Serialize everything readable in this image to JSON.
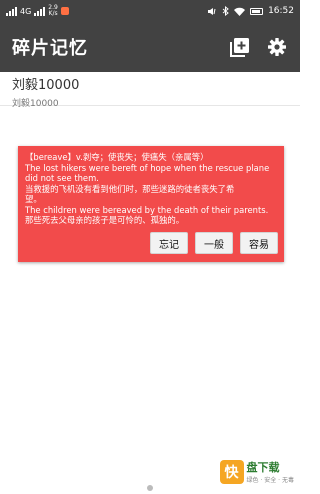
{
  "status_bar": {
    "signal_left": "4G",
    "speed_value": "2.9",
    "speed_unit": "K/s",
    "time": "16:52"
  },
  "app_bar": {
    "title": "碎片记忆",
    "add_icon": "add-note-icon",
    "settings_icon": "gear-icon"
  },
  "entry": {
    "title": "刘毅10000",
    "subtitle": "刘毅10000"
  },
  "card": {
    "lines": [
      "【bereave】v.剥夺；使丧失；使痛失（亲属等）",
      "The lost hikers were bereft of hope when the rescue plane",
      "did not see them.",
      "当救援的飞机没有看到他们时，那些迷路的徒者丧失了希",
      "望。",
      "The children were bereaved by the death of their parents.",
      "那些死去父母亲的孩子是可怜的、孤独的。"
    ],
    "buttons": [
      "忘记",
      "一般",
      "容易"
    ],
    "color": "#f24b4b"
  },
  "watermark": {
    "logo": "快",
    "name": "盘下载",
    "slogan": "绿色 · 安全 · 无毒"
  }
}
